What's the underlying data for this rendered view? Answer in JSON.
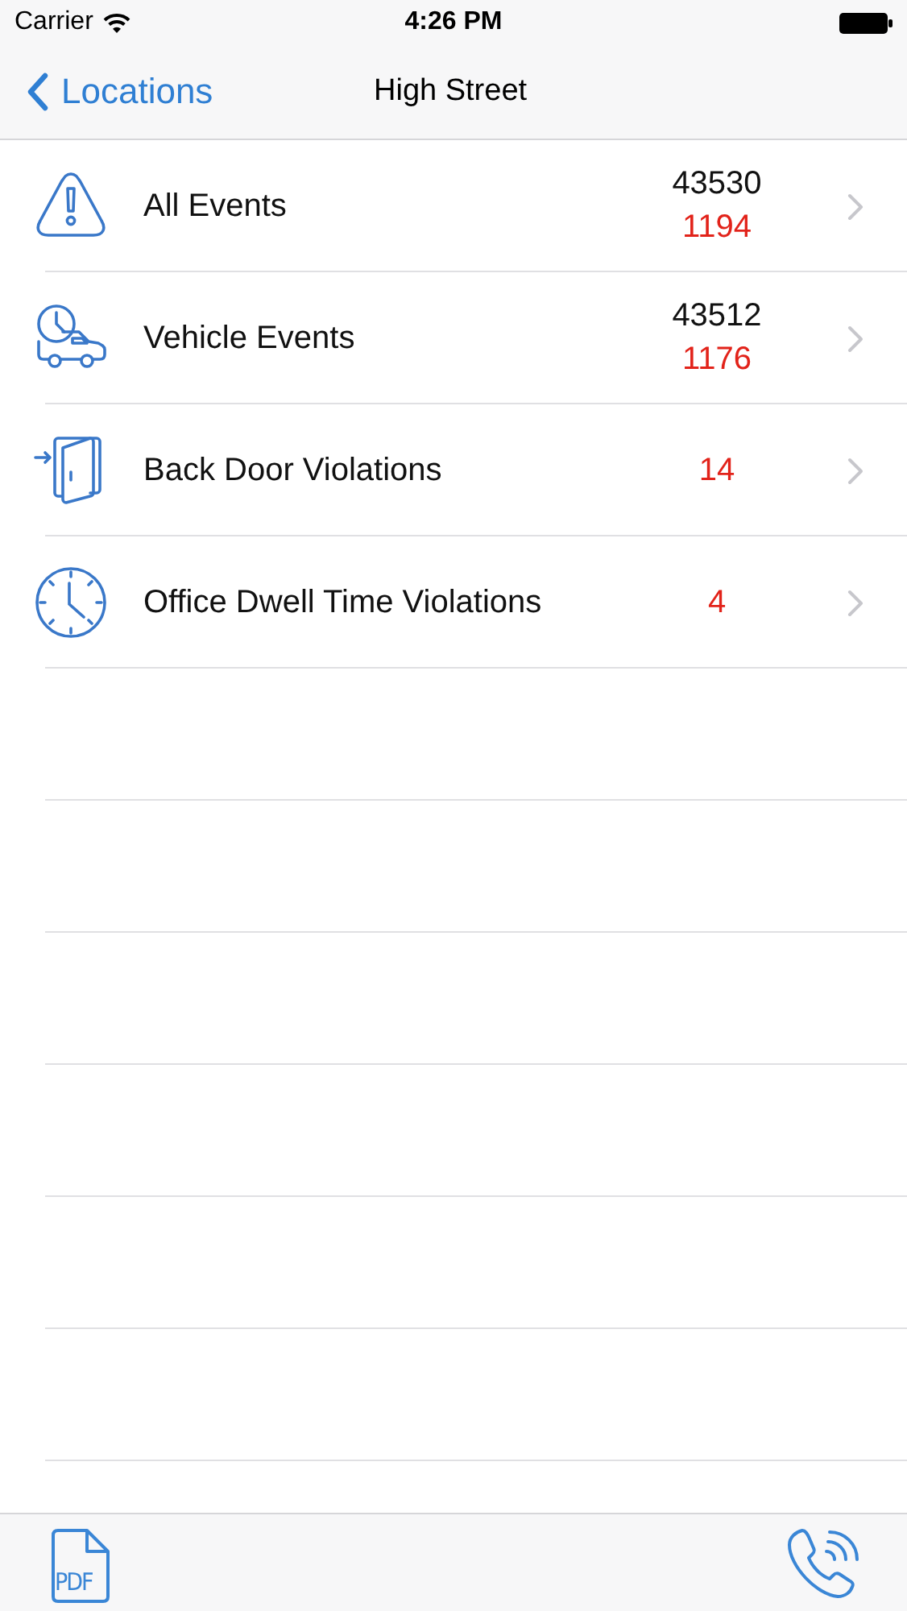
{
  "status_bar": {
    "carrier": "Carrier",
    "time": "4:26 PM"
  },
  "nav_bar": {
    "back_label": "Locations",
    "title": "High Street"
  },
  "rows": [
    {
      "kind": "alert",
      "label": "All Events",
      "total": "43530",
      "violations": "1194"
    },
    {
      "kind": "vehicle",
      "label": "Vehicle Events",
      "total": "43512",
      "violations": "1176"
    },
    {
      "kind": "door",
      "label": "Back Door Violations",
      "violations": "14"
    },
    {
      "kind": "clock",
      "label": "Office Dwell Time Violations",
      "violations": "4"
    }
  ],
  "toolbar": {
    "pdf_label": "PDF"
  }
}
